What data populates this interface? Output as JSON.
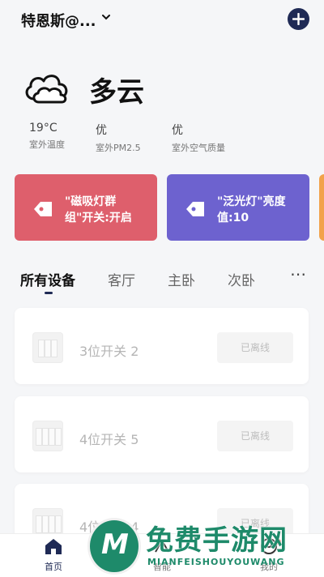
{
  "header": {
    "home_name": "特恩斯@..."
  },
  "weather": {
    "state": "多云",
    "metrics": [
      {
        "value": "19°C",
        "label": "室外温度"
      },
      {
        "value": "优",
        "label": "室外PM2.5"
      },
      {
        "value": "优",
        "label": "室外空气质量"
      }
    ]
  },
  "scenes": [
    {
      "text_line1": "\"磁吸灯群",
      "text_line2": "组\"开关:开启",
      "color": "#de5f6c"
    },
    {
      "text_line1": "\"泛光灯\"亮度",
      "text_line2": "值:10",
      "color": "#6d62cf"
    }
  ],
  "tabs": [
    "所有设备",
    "客厅",
    "主卧",
    "次卧"
  ],
  "devices": [
    {
      "name": "3位开关 2",
      "status": "已离线"
    },
    {
      "name": "4位开关 5",
      "status": "已离线"
    },
    {
      "name": "4位开关 4",
      "status": "已离线"
    }
  ],
  "bottom_nav": [
    {
      "label": "首页",
      "icon": "home-icon"
    },
    {
      "label": "智能",
      "icon": "smart-icon"
    },
    {
      "label": "我的",
      "icon": "profile-icon"
    }
  ],
  "watermark": {
    "logo": "M",
    "cn": "免费手游网",
    "en": "MIANFEISHOUYOUWANG"
  },
  "colors": {
    "accent": "#1f2a55",
    "red_scene": "#de5f6c",
    "purple_scene": "#6d62cf",
    "watermark": "#1e8a6a"
  }
}
